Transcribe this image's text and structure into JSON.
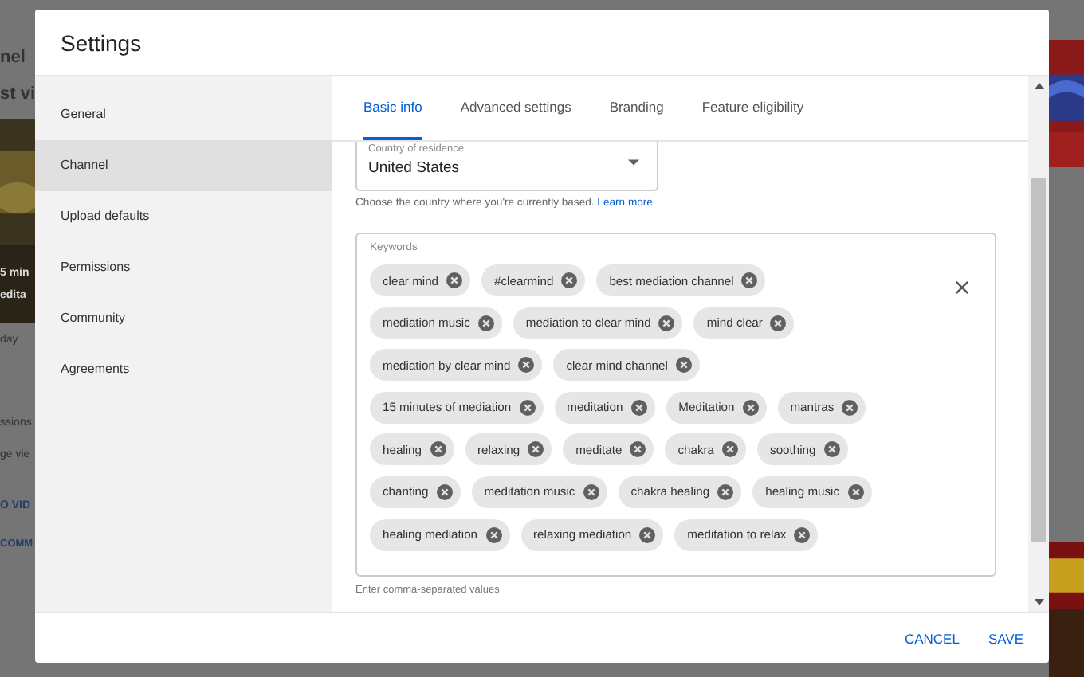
{
  "backdrop": {
    "left_texts": [
      "nel",
      "st vi",
      "5 min",
      "edita",
      "day",
      "ssions",
      "ge vie",
      "O VID",
      "COMM"
    ]
  },
  "dialog": {
    "title": "Settings"
  },
  "sidebar": {
    "items": [
      {
        "label": "General",
        "selected": false
      },
      {
        "label": "Channel",
        "selected": true
      },
      {
        "label": "Upload defaults",
        "selected": false
      },
      {
        "label": "Permissions",
        "selected": false
      },
      {
        "label": "Community",
        "selected": false
      },
      {
        "label": "Agreements",
        "selected": false
      }
    ]
  },
  "tabs": [
    {
      "label": "Basic info",
      "selected": true
    },
    {
      "label": "Advanced settings",
      "selected": false
    },
    {
      "label": "Branding",
      "selected": false
    },
    {
      "label": "Feature eligibility",
      "selected": false
    }
  ],
  "country": {
    "label": "Country of residence",
    "value": "United States",
    "helper": "Choose the country where you're currently based.",
    "link": "Learn more"
  },
  "keywords": {
    "label": "Keywords",
    "helper": "Enter comma-separated values",
    "chips": [
      "clear mind",
      "#clearmind",
      "best mediation channel",
      "mediation music",
      "mediation to clear mind",
      "mind clear",
      "mediation by clear mind",
      "clear mind channel",
      "15 minutes of mediation",
      "meditation",
      "Meditation",
      "mantras",
      "healing",
      "relaxing",
      "meditate",
      "chakra",
      "soothing",
      "chanting",
      "meditation music",
      "chakra healing",
      "healing music",
      "healing mediation",
      "relaxing mediation",
      "meditation to relax"
    ]
  },
  "buttons": [
    "CANCEL",
    "SAVE"
  ]
}
